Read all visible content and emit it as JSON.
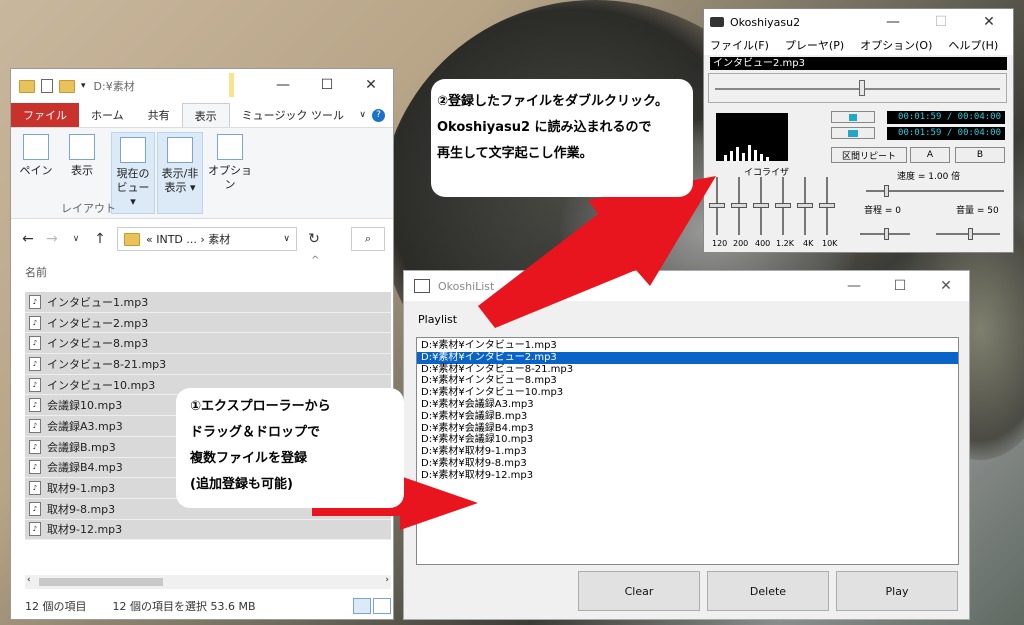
{
  "explorer": {
    "path": "D:¥素材",
    "tabs": [
      "ファイル",
      "ホーム",
      "共有",
      "表示",
      "ミュージック ツール"
    ],
    "ribbon": {
      "pane": "ペイン",
      "display": "表示",
      "current_view_line1": "現在の",
      "current_view_line2": "ビュー ▾",
      "showhide_line1": "表示/非",
      "showhide_line2": "表示 ▾",
      "options": "オプション",
      "group_layout": "レイアウト"
    },
    "address": "« INTD ... › 素材",
    "column_name": "名前",
    "files": [
      "インタビュー1.mp3",
      "インタビュー2.mp3",
      "インタビュー8.mp3",
      "インタビュー8-21.mp3",
      "インタビュー10.mp3",
      "会議録10.mp3",
      "会議録A3.mp3",
      "会議録B.mp3",
      "会議録B4.mp3",
      "取材9-1.mp3",
      "取材9-8.mp3",
      "取材9-12.mp3"
    ],
    "status_count": "12 個の項目",
    "status_selected": "12 個の項目を選択  53.6 MB"
  },
  "okoshilist": {
    "title": "OkoshiList",
    "playlist_label": "Playlist",
    "items": [
      "D:¥素材¥インタビュー1.mp3",
      "D:¥素材¥インタビュー2.mp3",
      "D:¥素材¥インタビュー8-21.mp3",
      "D:¥素材¥インタビュー8.mp3",
      "D:¥素材¥インタビュー10.mp3",
      "D:¥素材¥会議録A3.mp3",
      "D:¥素材¥会議録B.mp3",
      "D:¥素材¥会議録B4.mp3",
      "D:¥素材¥会議録10.mp3",
      "D:¥素材¥取材9-1.mp3",
      "D:¥素材¥取材9-8.mp3",
      "D:¥素材¥取材9-12.mp3"
    ],
    "selected_index": 1,
    "buttons": {
      "clear": "Clear",
      "delete": "Delete",
      "play": "Play"
    }
  },
  "okoshiyasu": {
    "title": "Okoshiyasu2",
    "menu": [
      "ファイル(F)",
      "プレーヤ(P)",
      "オプション(O)",
      "ヘルプ(H)"
    ],
    "current_file": "インタビュー2.mp3",
    "time1": "00:01:59 / 00:04:00",
    "time2": "00:01:59 / 00:04:00",
    "equalizer_label": "イコライザ",
    "section_repeat": "区間リピート",
    "a_button": "A",
    "b_button": "B",
    "speed": "速度 = 1.00 倍",
    "pitch": "音程 =  0",
    "volume": "音量 = 50",
    "freqs": [
      "120",
      "200",
      "400",
      "1.2K",
      "4K",
      "10K"
    ]
  },
  "callouts": {
    "step1": [
      "①エクスプローラーから",
      "ドラッグ＆ドロップで",
      "複数ファイルを登録",
      "(追加登録も可能)"
    ],
    "step2": [
      "②登録したファイルをダブルクリック。",
      "Okoshiyasu2 に読み込まれるので",
      "再生して文字起こし作業。"
    ]
  },
  "colors": {
    "selection": "#0a64c8",
    "arrow": "#e8141e",
    "file_tab": "#c8312c"
  }
}
